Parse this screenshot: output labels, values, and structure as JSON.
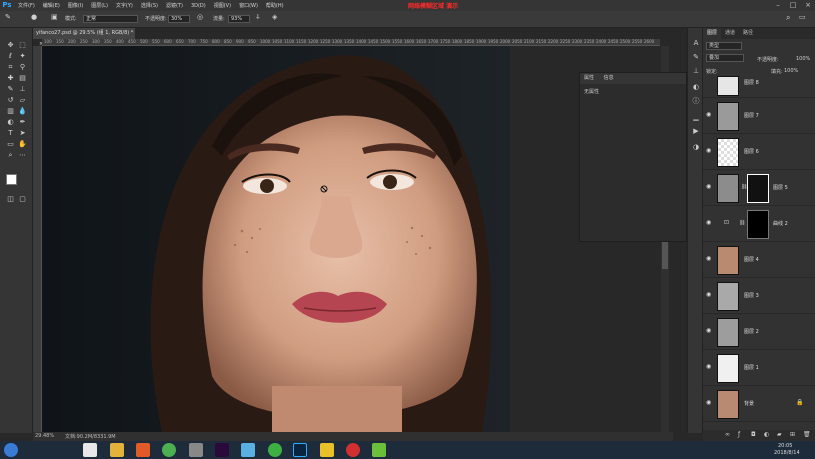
{
  "app": {
    "logo": "Ps",
    "watermark": "网络模糊区域 演示"
  },
  "menu": [
    "文件(F)",
    "编辑(E)",
    "图像(I)",
    "图层(L)",
    "文字(Y)",
    "选择(S)",
    "滤镜(T)",
    "3D(D)",
    "视图(V)",
    "窗口(W)",
    "帮助(H)"
  ],
  "options": {
    "mode_label": "模式:",
    "mode_value": "正常",
    "opacity_label": "不透明度:",
    "opacity_value": "30%",
    "flow_label": "流量:",
    "flow_value": "93%"
  },
  "document": {
    "tab_title": "yifanco27.psd @ 29.5% (组 1, RGB/8) *",
    "close": "×"
  },
  "ruler_ticks": [
    "100",
    "150",
    "200",
    "250",
    "300",
    "350",
    "400",
    "450",
    "500",
    "550",
    "600",
    "650",
    "700",
    "750",
    "800",
    "850",
    "900",
    "950",
    "1000",
    "1050",
    "1100",
    "1150",
    "1200",
    "1250",
    "1300",
    "1350",
    "1400",
    "1450",
    "1500",
    "1550",
    "1600",
    "1650",
    "1700",
    "1750",
    "1800",
    "1850",
    "1900",
    "1950",
    "2000",
    "2050",
    "2100",
    "2150",
    "2200",
    "2250",
    "2300",
    "2350",
    "2400",
    "2450",
    "2500",
    "2550",
    "2600"
  ],
  "status": {
    "zoom": "29.48%",
    "doc": "文档:90.2M/8331.9M"
  },
  "properties": {
    "tab1": "属性",
    "tab2": "信息",
    "content": "无属性"
  },
  "layers": {
    "tabs": [
      "图层",
      "通道",
      "路径"
    ],
    "kind": "类型",
    "blend": "叠加",
    "opacity_label": "不透明度:",
    "opacity": "100%",
    "lock_label": "锁定:",
    "fill_label": "填充:",
    "fill": "100%",
    "items": [
      {
        "name": "图层 8"
      },
      {
        "name": "图层 7"
      },
      {
        "name": "图层 6"
      },
      {
        "name": "图层 5"
      },
      {
        "name": "曲线 2"
      },
      {
        "name": "图层 4"
      },
      {
        "name": "图层 3"
      },
      {
        "name": "图层 2"
      },
      {
        "name": "图层 1"
      },
      {
        "name": "背景"
      }
    ]
  },
  "tray": {
    "time": "20:05",
    "date": "2018/8/14"
  },
  "colors": {
    "accent": "#31a8ff",
    "red": "#ff2a2a"
  }
}
